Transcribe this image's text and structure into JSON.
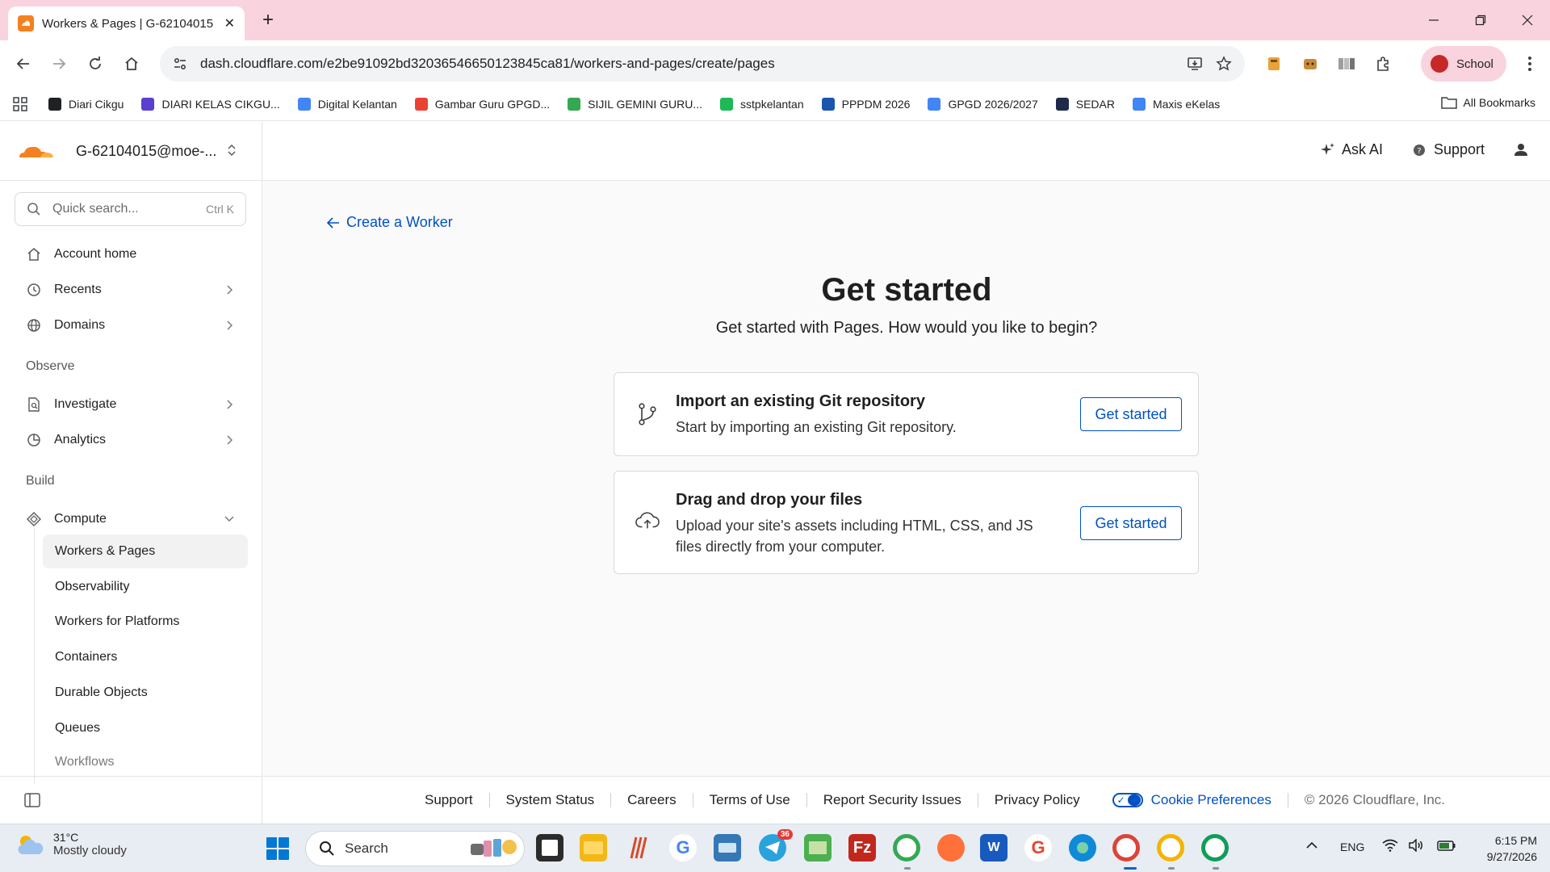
{
  "browser": {
    "tab_title": "Workers & Pages | G-62104015",
    "url": "dash.cloudflare.com/e2be91092bd32036546650123845ca81/workers-and-pages/create/pages",
    "profile_name": "School",
    "bookmarks": [
      {
        "label": "Diari Cikgu",
        "color": "#202124"
      },
      {
        "label": "DIARI KELAS CIKGU...",
        "color": "#5b3fd1"
      },
      {
        "label": "Digital Kelantan",
        "color": "#4285f4"
      },
      {
        "label": "Gambar Guru GPGD...",
        "color": "#ea4335"
      },
      {
        "label": "SIJIL GEMINI GURU...",
        "color": "#34a853"
      },
      {
        "label": "sstpkelantan",
        "color": "#1db954"
      },
      {
        "label": "PPPDM 2026",
        "color": "#1a56b0"
      },
      {
        "label": "GPGD 2026/2027",
        "color": "#4285f4"
      },
      {
        "label": "SEDAR",
        "color": "#1e2a4a"
      },
      {
        "label": "Maxis eKelas",
        "color": "#4285f4"
      }
    ],
    "all_bookmarks": "All Bookmarks"
  },
  "sidebar": {
    "account": "G-62104015@moe-...",
    "search_placeholder": "Quick search...",
    "search_shortcut": "Ctrl K",
    "items": {
      "account_home": "Account home",
      "recents": "Recents",
      "domains": "Domains",
      "observe": "Observe",
      "investigate": "Investigate",
      "analytics": "Analytics",
      "build": "Build",
      "compute": "Compute"
    },
    "compute_children": [
      "Workers & Pages",
      "Observability",
      "Workers for Platforms",
      "Containers",
      "Durable Objects",
      "Queues",
      "Workflows"
    ]
  },
  "topbar": {
    "ask_ai": "Ask AI",
    "support": "Support"
  },
  "main": {
    "back_link": "Create a Worker",
    "title": "Get started",
    "subtitle": "Get started with Pages. How would you like to begin?",
    "cards": [
      {
        "title": "Import an existing Git repository",
        "description": "Start by importing an existing Git repository.",
        "button": "Get started",
        "icon": "git-branch-icon"
      },
      {
        "title": "Drag and drop your files",
        "description": "Upload your site's assets including HTML, CSS, and JS files directly from your computer.",
        "button": "Get started",
        "icon": "cloud-upload-icon"
      }
    ]
  },
  "footer": {
    "links": [
      "Support",
      "System Status",
      "Careers",
      "Terms of Use",
      "Report Security Issues",
      "Privacy Policy"
    ],
    "cookie": "Cookie Preferences",
    "copyright": "© 2026 Cloudflare, Inc."
  },
  "taskbar": {
    "weather_temp": "31°C",
    "weather_desc": "Mostly cloudy",
    "search": "Search",
    "badge": "36",
    "lang": "ENG",
    "time": "6:15 PM",
    "date": "9/27/2026"
  },
  "colors": {
    "accent": "#0051c3",
    "cloudflare_orange": "#f4811f",
    "tabstrip": "#f9d3dd"
  }
}
